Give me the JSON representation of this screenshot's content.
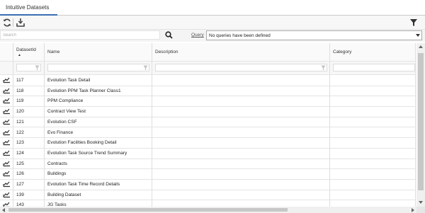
{
  "tab": {
    "title": "Intuitive Datasets"
  },
  "toolbar": {
    "refresh_icon": "refresh-icon",
    "export_icon": "export-icon",
    "filter_icon": "filter-icon"
  },
  "search": {
    "placeholder": "Search",
    "icon": "magnifier-icon"
  },
  "query": {
    "label": "Query",
    "value": "No queries have been defined"
  },
  "grid": {
    "columns": [
      {
        "key": "dataset_id",
        "label": "DatasetId"
      },
      {
        "key": "name",
        "label": "Name"
      },
      {
        "key": "description",
        "label": "Description"
      },
      {
        "key": "category",
        "label": "Category"
      }
    ],
    "rows": [
      {
        "dataset_id": "117",
        "name": "Evolution Task Detail",
        "description": "",
        "category": ""
      },
      {
        "dataset_id": "118",
        "name": "Evolution PPM Task Planner Class1",
        "description": "",
        "category": ""
      },
      {
        "dataset_id": "119",
        "name": "PPM Compliance",
        "description": "",
        "category": ""
      },
      {
        "dataset_id": "120",
        "name": "Contract View Test",
        "description": "",
        "category": ""
      },
      {
        "dataset_id": "121",
        "name": "Evolution CSF",
        "description": "",
        "category": ""
      },
      {
        "dataset_id": "122",
        "name": "Evo Finance",
        "description": "",
        "category": ""
      },
      {
        "dataset_id": "123",
        "name": "Evolution Facilities Booking Detail",
        "description": "",
        "category": ""
      },
      {
        "dataset_id": "124",
        "name": "Evolution Task Source Trend Summary",
        "description": "",
        "category": ""
      },
      {
        "dataset_id": "125",
        "name": "Contracts",
        "description": "",
        "category": ""
      },
      {
        "dataset_id": "126",
        "name": "Buildings",
        "description": "",
        "category": ""
      },
      {
        "dataset_id": "127",
        "name": "Evolution Task Time Record Details",
        "description": "",
        "category": ""
      },
      {
        "dataset_id": "139",
        "name": "Building Dataset",
        "description": "",
        "category": ""
      },
      {
        "dataset_id": "143",
        "name": "JG Tasks",
        "description": "",
        "category": ""
      }
    ]
  },
  "colors": {
    "tab_underline": "#3a6fb0",
    "grid_line": "#e4e4e4",
    "scrollbar_thumb": "#c7c7c7"
  }
}
